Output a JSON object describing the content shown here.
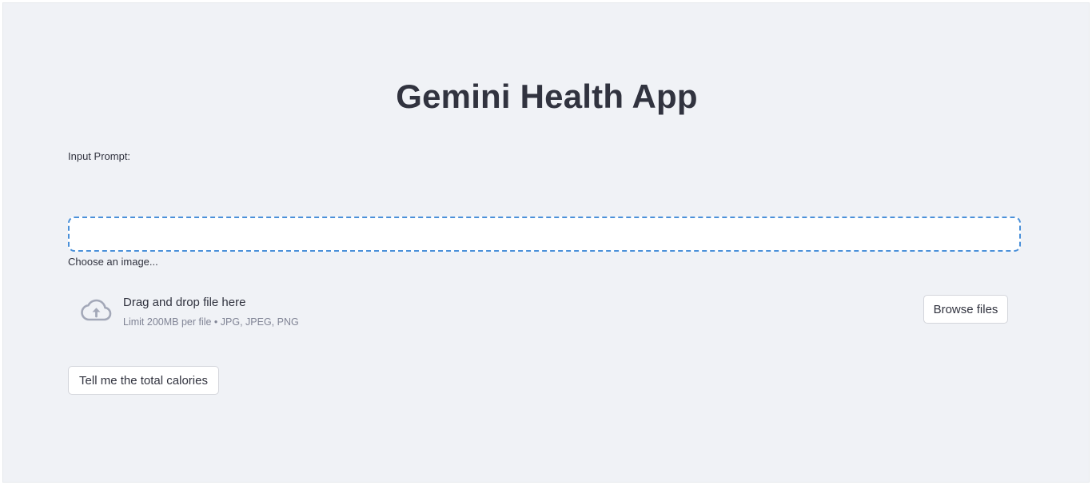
{
  "header": {
    "title": "Gemini Health App"
  },
  "prompt": {
    "label": "Input Prompt:",
    "value": "",
    "placeholder": ""
  },
  "uploader": {
    "label": "Choose an image...",
    "drop_text": "Drag and drop file here",
    "limit_text": "Limit 200MB per file • JPG, JPEG, PNG",
    "browse_label": "Browse files",
    "icon": "cloud-upload-icon"
  },
  "actions": {
    "submit_label": "Tell me the total calories"
  },
  "colors": {
    "background": "#f0f2f6",
    "text": "#31333f",
    "muted_text": "#808495",
    "focus_border": "#4a90d9",
    "icon": "#a3a8b8"
  }
}
